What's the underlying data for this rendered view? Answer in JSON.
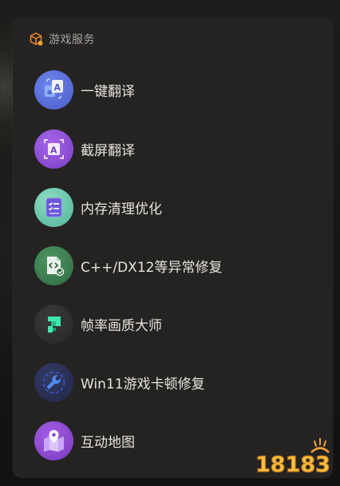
{
  "panel": {
    "title": "游戏服务",
    "icon": "package-box-icon"
  },
  "items": [
    {
      "label": "一键翻译",
      "icon": "translate-icon",
      "color": "#5a6fd8"
    },
    {
      "label": "截屏翻译",
      "icon": "screenshot-translate-icon",
      "color": "#8e4fd6"
    },
    {
      "label": "内存清理优化",
      "icon": "memory-clean-icon",
      "color": "#5bbfa6"
    },
    {
      "label": "C++/DX12等异常修复",
      "icon": "code-repair-icon",
      "color": "#3f7d52"
    },
    {
      "label": "帧率画质大师",
      "icon": "frame-rate-icon",
      "color": "#2f2f2f"
    },
    {
      "label": "Win11游戏卡顿修复",
      "icon": "wrench-icon",
      "color": "#2a2f52"
    },
    {
      "label": "互动地图",
      "icon": "map-pin-icon",
      "color": "#8a49c9"
    }
  ],
  "watermark": {
    "text": "18183"
  }
}
